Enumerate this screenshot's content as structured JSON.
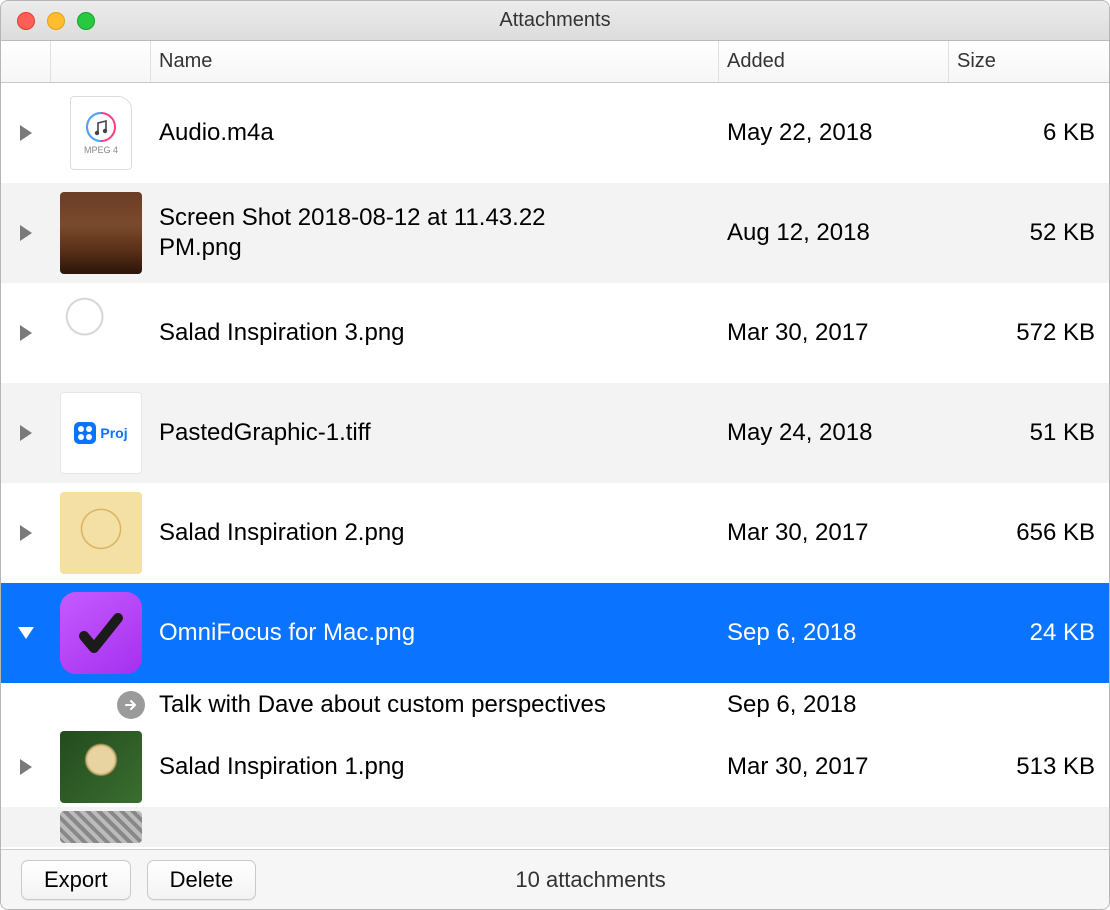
{
  "window": {
    "title": "Attachments"
  },
  "headers": {
    "name": "Name",
    "added": "Added",
    "size": "Size"
  },
  "rows": [
    {
      "name": "Audio.m4a",
      "added": "May 22, 2018",
      "size": "6 KB",
      "icon": "audio",
      "tag": "MPEG 4",
      "expanded": false,
      "selected": false
    },
    {
      "name": "Screen Shot 2018-08-12 at 11.43.22 PM.png",
      "added": "Aug 12, 2018",
      "size": "52 KB",
      "icon": "wood",
      "expanded": false,
      "selected": false
    },
    {
      "name": "Salad Inspiration 3.png",
      "added": "Mar 30, 2017",
      "size": "572 KB",
      "icon": "salad",
      "expanded": false,
      "selected": false
    },
    {
      "name": "PastedGraphic-1.tiff",
      "added": "May 24, 2018",
      "size": "51 KB",
      "icon": "graphic",
      "graphic_text": "Proj",
      "expanded": false,
      "selected": false
    },
    {
      "name": "Salad Inspiration 2.png",
      "added": "Mar 30, 2017",
      "size": "656 KB",
      "icon": "salad2",
      "expanded": false,
      "selected": false
    },
    {
      "name": "OmniFocus for Mac.png",
      "added": "Sep 6, 2018",
      "size": "24 KB",
      "icon": "omnifocus",
      "expanded": true,
      "selected": true
    },
    {
      "name": "Salad Inspiration 1.png",
      "added": "Mar 30, 2017",
      "size": "513 KB",
      "icon": "salad3",
      "expanded": false,
      "selected": false
    }
  ],
  "sub": {
    "name": "Talk with Dave about custom perspectives",
    "added": "Sep 6, 2018",
    "size": ""
  },
  "footer": {
    "export": "Export",
    "delete": "Delete",
    "status": "10 attachments"
  }
}
